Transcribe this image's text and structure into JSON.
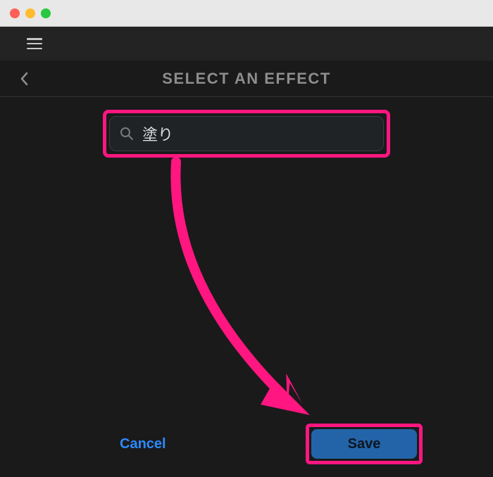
{
  "header": {
    "title": "SELECT AN EFFECT"
  },
  "search": {
    "value": "塗り",
    "placeholder": ""
  },
  "footer": {
    "cancel_label": "Cancel",
    "save_label": "Save"
  },
  "annotation": {
    "highlight_color": "#ff1680"
  }
}
